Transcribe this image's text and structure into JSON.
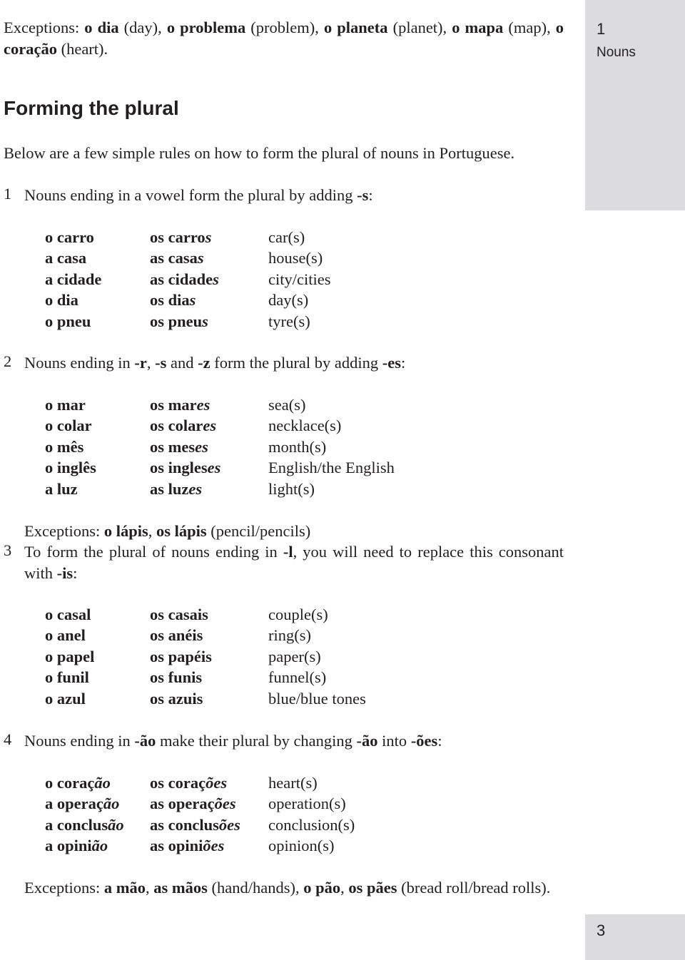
{
  "sidebar": {
    "chapter_number": "1",
    "chapter_name": "Nouns",
    "page_number": "3"
  },
  "intro_exceptions": {
    "parts": [
      {
        "t": "Exceptions: ",
        "b": false
      },
      {
        "t": "o dia",
        "b": true
      },
      {
        "t": " (day), ",
        "b": false
      },
      {
        "t": "o problema",
        "b": true
      },
      {
        "t": " (problem), ",
        "b": false
      },
      {
        "t": "o planeta",
        "b": true
      },
      {
        "t": " (planet), ",
        "b": false
      },
      {
        "t": "o mapa",
        "b": true
      },
      {
        "t": " (map), ",
        "b": false
      },
      {
        "t": "o coração",
        "b": true
      },
      {
        "t": " (heart).",
        "b": false
      }
    ]
  },
  "heading": "Forming the plural",
  "lead": "Below are a few simple rules on how to form the plural of nouns in Portuguese.",
  "rules": [
    {
      "number": "1",
      "parts": [
        {
          "t": "Nouns ending in a vowel form the plural by adding ",
          "b": false
        },
        {
          "t": "-s",
          "b": true
        },
        {
          "t": ":",
          "b": false
        }
      ],
      "rows": [
        {
          "sg": "o carro",
          "pl_stem": "os carro",
          "pl_end": "s",
          "en": "car(s)"
        },
        {
          "sg": "a casa",
          "pl_stem": "as casa",
          "pl_end": "s",
          "en": "house(s)"
        },
        {
          "sg": "a cidade",
          "pl_stem": "as cidade",
          "pl_end": "s",
          "en": "city/cities"
        },
        {
          "sg": "o dia",
          "pl_stem": "os dia",
          "pl_end": "s",
          "en": "day(s)"
        },
        {
          "sg": "o pneu",
          "pl_stem": "os pneu",
          "pl_end": "s",
          "en": "tyre(s)"
        }
      ]
    },
    {
      "number": "2",
      "parts": [
        {
          "t": "Nouns ending in ",
          "b": false
        },
        {
          "t": "-r",
          "b": true
        },
        {
          "t": ", ",
          "b": false
        },
        {
          "t": "-s",
          "b": true
        },
        {
          "t": " and ",
          "b": false
        },
        {
          "t": "-z",
          "b": true
        },
        {
          "t": " form the plural by adding ",
          "b": false
        },
        {
          "t": "-es",
          "b": true
        },
        {
          "t": ":",
          "b": false
        }
      ],
      "rows": [
        {
          "sg": "o mar",
          "pl_stem": "os mar",
          "pl_end": "es",
          "en": "sea(s)"
        },
        {
          "sg": "o colar",
          "pl_stem": "os colar",
          "pl_end": "es",
          "en": "necklace(s)"
        },
        {
          "sg": "o mês",
          "pl_stem": "os mes",
          "pl_end": "es",
          "en": "month(s)"
        },
        {
          "sg": "o inglês",
          "pl_stem": "os ingles",
          "pl_end": "es",
          "en": "English/the English"
        },
        {
          "sg": "a luz",
          "pl_stem": "as luz",
          "pl_end": "es",
          "en": "light(s)"
        }
      ],
      "exceptions": [
        {
          "t": "Exceptions: ",
          "b": false
        },
        {
          "t": "o lápis",
          "b": true
        },
        {
          "t": ", ",
          "b": false
        },
        {
          "t": "os lápis",
          "b": true
        },
        {
          "t": " (pencil/pencils)",
          "b": false
        }
      ]
    },
    {
      "number": "3",
      "parts": [
        {
          "t": "To form the plural of nouns ending in ",
          "b": false
        },
        {
          "t": "-l",
          "b": true
        },
        {
          "t": ", you will need to replace this consonant with ",
          "b": false
        },
        {
          "t": "-is",
          "b": true
        },
        {
          "t": ":",
          "b": false
        }
      ],
      "rows": [
        {
          "sg": "o casal",
          "pl_stem": "os casais",
          "pl_end": "",
          "en": "couple(s)"
        },
        {
          "sg": "o anel",
          "pl_stem": "os anéis",
          "pl_end": "",
          "en": "ring(s)"
        },
        {
          "sg": "o papel",
          "pl_stem": "os papéis",
          "pl_end": "",
          "en": "paper(s)"
        },
        {
          "sg": "o funil",
          "pl_stem": "os funis",
          "pl_end": "",
          "en": "funnel(s)"
        },
        {
          "sg": "o azul",
          "pl_stem": "os azuis",
          "pl_end": "",
          "en": "blue/blue tones"
        }
      ]
    },
    {
      "number": "4",
      "parts": [
        {
          "t": "Nouns ending in ",
          "b": false
        },
        {
          "t": "-ão",
          "b": true
        },
        {
          "t": " make their plural by changing ",
          "b": false
        },
        {
          "t": "-ão",
          "b": true
        },
        {
          "t": " into ",
          "b": false
        },
        {
          "t": "-ões",
          "b": true
        },
        {
          "t": ":",
          "b": false
        }
      ],
      "rows": [
        {
          "sg_stem": "o coraç",
          "sg_end": "ão",
          "pl_stem": "os coraç",
          "pl_end": "ões",
          "en": "heart(s)"
        },
        {
          "sg_stem": "a operaç",
          "sg_end": "ão",
          "pl_stem": "as operaç",
          "pl_end": "ões",
          "en": "operation(s)"
        },
        {
          "sg_stem": "a conclus",
          "sg_end": "ão",
          "pl_stem": "as conclus",
          "pl_end": "ões",
          "en": "conclusion(s)"
        },
        {
          "sg_stem": "a opini",
          "sg_end": "ão",
          "pl_stem": "as opini",
          "pl_end": "ões",
          "en": "opinion(s)"
        }
      ],
      "exceptions": [
        {
          "t": "Exceptions: ",
          "b": false
        },
        {
          "t": "a mão",
          "b": true
        },
        {
          "t": ", ",
          "b": false
        },
        {
          "t": "as mãos",
          "b": true
        },
        {
          "t": " (hand/hands), ",
          "b": false
        },
        {
          "t": "o pão",
          "b": true
        },
        {
          "t": ", ",
          "b": false
        },
        {
          "t": "os pães",
          "b": true
        },
        {
          "t": " (bread roll/bread rolls).",
          "b": false
        }
      ]
    }
  ]
}
